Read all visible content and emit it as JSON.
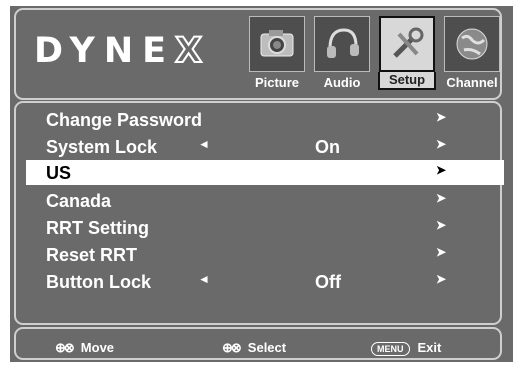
{
  "brand": {
    "logo_left": "DYNE",
    "logo_right": "X"
  },
  "tabs": [
    {
      "label": "Picture",
      "icon": "camera-icon"
    },
    {
      "label": "Audio",
      "icon": "headphones-icon"
    },
    {
      "label": "Setup",
      "icon": "tools-icon",
      "active": true
    },
    {
      "label": "Channel",
      "icon": "globe-icon"
    }
  ],
  "menu": {
    "items": [
      {
        "label": "Change Password",
        "left": "",
        "value": "",
        "right": "➤"
      },
      {
        "label": "System Lock",
        "left": "◄",
        "value": "On",
        "right": "➤"
      },
      {
        "label": "US",
        "left": "",
        "value": "",
        "right": "➤",
        "selected": true
      },
      {
        "label": "Canada",
        "left": "",
        "value": "",
        "right": "➤"
      },
      {
        "label": "RRT Setting",
        "left": "",
        "value": "",
        "right": "➤"
      },
      {
        "label": "Reset RRT",
        "left": "",
        "value": "",
        "right": "➤"
      },
      {
        "label": "Button Lock",
        "left": "◄",
        "value": "Off",
        "right": "➤"
      }
    ]
  },
  "footer": {
    "move_glyph": "⊕⊗",
    "move_label": "Move",
    "select_glyph": "⊕⊗",
    "select_label": "Select",
    "menu_key": "MENU",
    "exit_label": "Exit"
  },
  "colors": {
    "background": "#6a6a6a",
    "selected_row": "#ffffff",
    "text": "#ffffff"
  }
}
